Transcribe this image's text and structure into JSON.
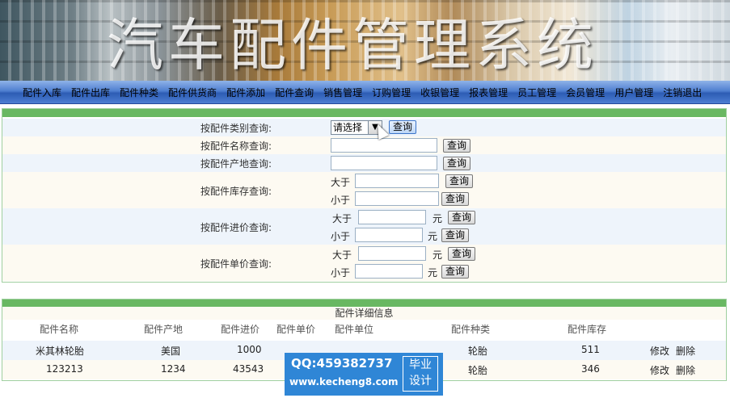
{
  "banner": {
    "title": "汽车配件管理系统"
  },
  "nav": [
    "配件入库",
    "配件出库",
    "配件种类",
    "配件供货商",
    "配件添加",
    "配件查询",
    "销售管理",
    "订购管理",
    "收银管理",
    "报表管理",
    "员工管理",
    "会员管理",
    "用户管理",
    "注销退出"
  ],
  "search": {
    "category_label": "按配件类别查询:",
    "category_select": "请选择",
    "name_label": "按配件名称查询:",
    "origin_label": "按配件产地查询:",
    "stock_label": "按配件库存查询:",
    "purchase_label": "按配件进价查询:",
    "unit_price_label": "按配件单价查询:",
    "greater": "大于",
    "less": "小于",
    "yuan": "元",
    "query_button": "查询"
  },
  "detail": {
    "title": "配件详细信息",
    "headers": [
      "配件名称",
      "配件产地",
      "配件进价",
      "配件单价",
      "配件单位",
      "配件种类",
      "配件库存"
    ],
    "rows": [
      {
        "name": "米其林轮胎",
        "origin": "美国",
        "purchase": "1000",
        "category": "轮胎",
        "stock": "511",
        "edit": "修改",
        "delete": "删除"
      },
      {
        "name": "123213",
        "origin": "1234",
        "purchase": "43543",
        "category": "轮胎",
        "stock": "346",
        "edit": "修改",
        "delete": "删除"
      }
    ]
  },
  "watermark": {
    "qq": "QQ:459382737",
    "url": "www.kecheng8.com",
    "logo_line1": "毕业",
    "logo_line2": "设计"
  }
}
